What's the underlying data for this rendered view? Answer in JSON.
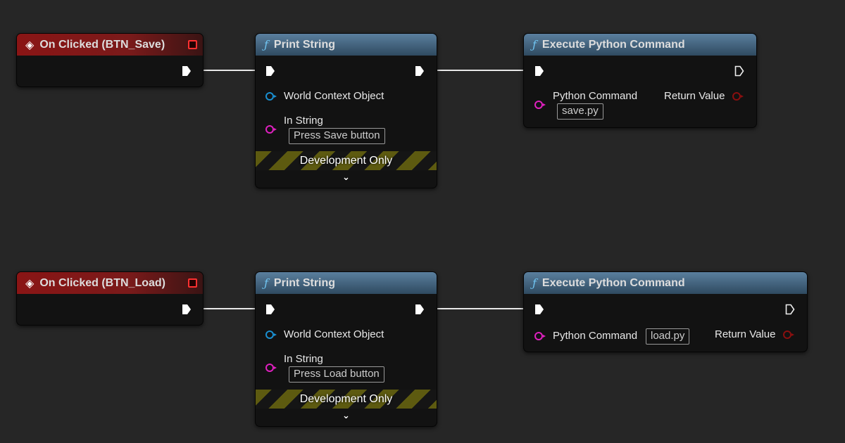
{
  "graphs": [
    {
      "event": {
        "title": "On Clicked (BTN_Save)"
      },
      "print": {
        "title": "Print String",
        "world_context": "World Context Object",
        "in_string_label": "In String",
        "in_string_value": "Press Save button",
        "dev_only": "Development Only"
      },
      "exec": {
        "title": "Execute Python Command",
        "python_command_label": "Python Command",
        "python_command_value": "save.py",
        "return_label": "Return Value"
      }
    },
    {
      "event": {
        "title": "On Clicked (BTN_Load)"
      },
      "print": {
        "title": "Print String",
        "world_context": "World Context Object",
        "in_string_label": "In String",
        "in_string_value": "Press Load button",
        "dev_only": "Development Only"
      },
      "exec": {
        "title": "Execute Python Command",
        "python_command_label": "Python Command",
        "python_command_value": "load.py",
        "return_label": "Return Value"
      }
    }
  ],
  "icons": {
    "event": "event-diamond-icon",
    "function": "function-f-icon",
    "exec": "exec-pin-icon"
  },
  "colors": {
    "event_header": "#8a1515",
    "function_header": "#4a6a85",
    "object_pin": "#1a8fd0",
    "string_pin": "#e020c0",
    "bool_pin": "#8a0f0f",
    "dev_stripe": "#5d5a10"
  }
}
